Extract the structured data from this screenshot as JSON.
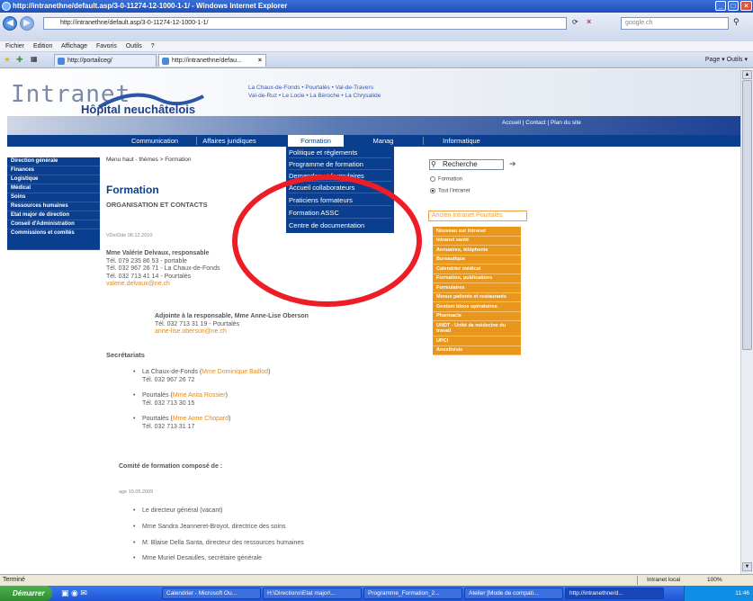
{
  "browser": {
    "title": "http://intranethne/default.asp/3-0-11274-12-1000-1-1/ - Windows Internet Explorer",
    "address": "http://intranethne/default.asp/3-0-11274-12-1000-1-1/",
    "search_placeholder": "google.ch",
    "menu": [
      "Fichier",
      "Edition",
      "Affichage",
      "Favoris",
      "Outils",
      "?"
    ],
    "tabs": [
      "http://portailceg/",
      "http://intranethne/defau..."
    ],
    "toolbar_right": "Page ▾  Outils ▾",
    "status_left": "Terminé",
    "zone": "Intranet local",
    "zoom": "100%"
  },
  "header": {
    "logo_main": "Intranet",
    "logo_sub": "Hôpital neuchâtelois",
    "sites_line1": "La Chaux-de-Fonds  •  Pourtalès  •  Val-de-Travers",
    "sites_line2": "Val-de-Ruz  •  Le Locle  •  La Béroche  •  La Chrysalide",
    "toplinks": "Accueil | Contact | Plan du site"
  },
  "nav": {
    "items": [
      "Communication",
      "Affaires juridiques",
      "Formation",
      "Manag",
      "Informatique"
    ]
  },
  "dropdown": {
    "items": [
      "Politique et règlements",
      "Programme de formation",
      "Demandes et formulaires",
      "Accueil collaborateurs",
      "Praticiens formateurs",
      "Formation ASSC",
      "Centre de documentation"
    ]
  },
  "leftnav": {
    "items": [
      "Direction générale",
      "Finances",
      "Logistique",
      "Médical",
      "Soins",
      "Ressources humaines",
      "Etat major de direction",
      "Conseil d'Administration",
      "Commissions et comités"
    ]
  },
  "main": {
    "breadcrumb": "Menu haut - thèmes > Formation",
    "title": "Formation",
    "subtitle": "ORGANISATION ET CONTACTS",
    "meta1": "VDe/Dde 08.12.2010",
    "resp_name": "Mme Valérie Delvaux, responsable",
    "resp_tel1": "Tél. 079 235 86 53 - portable",
    "resp_tel2": "Tél. 032 967 26 71 - La Chaux-de-Fonds",
    "resp_tel3": "Tél. 032 713 41 14 - Pourtalès",
    "resp_email": "valerie.delvaux@ne.ch",
    "adj_name": "Adjointe à la responsable, Mme Anne-Lise Oberson",
    "adj_tel": "Tél. 032 713 31 19 - Pourtalès",
    "adj_email": "anne-lise.oberson@ne.ch",
    "secretariats_title": "Secrétariats",
    "sec1_place": "La Chaux-de-Fonds (",
    "sec1_name": "Mme Dominique Baillod",
    "sec1_tel": "Tél. 032 967 26 72",
    "sec2_place": "Pourtalès (",
    "sec2_name": "Mme Anita Rossier",
    "sec2_tel": "Tél. 032 713 30 15",
    "sec3_place": "Pourtalès (",
    "sec3_name": "Mme Anne Chopard",
    "sec3_tel": "Tél. 032 713 31 17",
    "comite_title": "Comité de formation composé de :",
    "meta2": "age 19.05.2009",
    "comite": [
      "Le directeur général (vacant)",
      "Mme Sandra Jeanneret-Broyot, directrice des soins",
      "M. Blaise Della Santa, directeur des ressources humaines",
      "Mme Muriel Desaulles, secrétaire générale"
    ]
  },
  "right": {
    "search_label": "Recherche",
    "radio1": "Formation",
    "radio2": "Tout l'intranet",
    "ancien": "Ancien Intranet Pourtalès",
    "links": [
      "Nouveau sur Intranet",
      "Intranet santé",
      "Annuaires, téléphonie",
      "Bureautique",
      "Calendrier médical",
      "Formation, publications",
      "Formulaires",
      "Menus patients et restaurants",
      "Gestion blocs opératoires",
      "Pharmacie",
      "UNDT - Unité de médecine du travail",
      "UPCI",
      "Anesthésie"
    ]
  },
  "taskbar": {
    "start": "Démarrer",
    "tasks": [
      "Calendrier - Microsoft Ou...",
      "H:\\Directions\\Etat major\\...",
      "Programme_Formation_2...",
      "Atelier [Mode de compati...",
      "http://intranethne/d..."
    ],
    "clock": "11:46"
  }
}
